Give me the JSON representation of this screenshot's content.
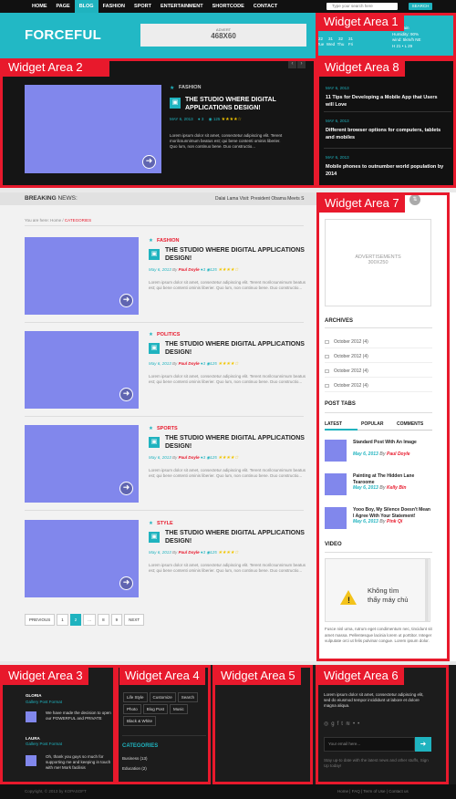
{
  "topnav": {
    "items": [
      "HOME",
      "PAGE",
      "BLOG",
      "FASHION",
      "SPORT",
      "ENTERTAINMENT",
      "SHORTCODE",
      "CONTACT"
    ],
    "active_index": 2,
    "search_placeholder": "Type your search here",
    "search_button": "SEARCH"
  },
  "header": {
    "logo": "FORCEFUL",
    "advert_small": "ADVERT",
    "advert_size": "468X60",
    "calendar": [
      {
        "day": "22",
        "wd": "Tue"
      },
      {
        "day": "31",
        "wd": "Wed"
      },
      {
        "day": "32",
        "wd": "Thu"
      },
      {
        "day": "31",
        "wd": "Fri"
      }
    ],
    "weather": [
      "Light rain",
      "Humidity: 90%",
      "wind: 5km/h NE",
      "H 21 • L 29"
    ]
  },
  "widget_labels": {
    "wa1": "Widget Area 1",
    "wa2": "Widget Area 2",
    "wa3": "Widget Area 3",
    "wa4": "Widget Area 4",
    "wa5": "Widget Area 5",
    "wa6": "Widget Area 6",
    "wa7": "Widget Area 7",
    "wa8": "Widget Area 8"
  },
  "featured": {
    "category": "FASHION",
    "title": "THE STUDIO WHERE DIGITAL APPLICATIONS DESIGN!",
    "date": "MAY 6, 2013",
    "comments": "3",
    "views": "125",
    "stars": "★★★★☆",
    "excerpt": "Lorem ipsum dolor sit amet, consectetur adipiscing elit. Terent morilcsunnimum beatus est; qui bene contenti ominis liberier. Quo lum, non continuo bene. Duo constructio..."
  },
  "right_news": [
    {
      "date": "MAY 6, 2013",
      "title": "11 Tips for Developing a Mobile App that Users will Love"
    },
    {
      "date": "MAY 6, 2013",
      "title": "Different browser options for computers, tablets and mobiles"
    },
    {
      "date": "MAY 6, 2013",
      "title": "Mobile phones to outnumber world population by 2014"
    }
  ],
  "breaking": {
    "label_bold": "BREAKING",
    "label_rest": " NEWS:",
    "ticker": "Dalai Lama Visit: President Obama Meets S"
  },
  "breadcrumb": {
    "prefix": "You are here:",
    "home": "Home",
    "sep": " / ",
    "current": "CATEGORIES"
  },
  "posts": [
    {
      "category": "FASHION",
      "title": "THE STUDIO WHERE DIGITAL APPLICATIONS DESIGN!",
      "date": "May 6, 2013",
      "author": "Paul Doyle",
      "comments": "3",
      "views": "125",
      "stars": "★★★★☆",
      "excerpt": "Lorem ipsum dolor sit amet, consectetur adipiscing elit. Terent morilcsunnimum beatus est; qui bene contenti ominis liberier. Quo lum, non continuo bene. Duo constructio..."
    },
    {
      "category": "POLITICS",
      "title": "THE STUDIO WHERE DIGITAL APPLICATIONS DESIGN!",
      "date": "May 6, 2013",
      "author": "Paul Doyle",
      "comments": "3",
      "views": "125",
      "stars": "★★★★☆",
      "excerpt": "Lorem ipsum dolor sit amet, consectetur adipiscing elit. Terent morilcsunnimum beatus est; qui bene contenti ominis liberier. Quo lum, non continuo bene. Duo constructio..."
    },
    {
      "category": "SPORTS",
      "title": "THE STUDIO WHERE DIGITAL APPLICATIONS DESIGN!",
      "date": "May 6, 2013",
      "author": "Paul Doyle",
      "comments": "3",
      "views": "125",
      "stars": "★★★★☆",
      "excerpt": "Lorem ipsum dolor sit amet, consectetur adipiscing elit. Terent morilcsunnimum beatus est; qui bene contenti ominis liberier. Quo lum, non continuo bene. Duo constructio..."
    },
    {
      "category": "STYLE",
      "title": "THE STUDIO WHERE DIGITAL APPLICATIONS DESIGN!",
      "date": "May 6, 2013",
      "author": "Paul Doyle",
      "comments": "3",
      "views": "125",
      "stars": "★★★★☆",
      "excerpt": "Lorem ipsum dolor sit amet, consectetur adipiscing elit. Terent morilcsunnimum beatus est; qui bene contenti ominis liberier. Quo lum, non continuo bene. Duo constructio..."
    }
  ],
  "pagination": {
    "prev": "PREVIOUS",
    "pages": [
      "1",
      "2",
      "...",
      "8",
      "9"
    ],
    "active": "2",
    "next": "NEXT"
  },
  "sidebar": {
    "ad_text": "ADVERTISEMENTS",
    "ad_size": "300X250",
    "archives_title": "ARCHIVES",
    "archives": [
      "October 2012 (4)",
      "October 2012 (4)",
      "October 2012 (4)",
      "October 2012 (4)"
    ],
    "posttabs_title": "POST TABS",
    "tabs": [
      "LATEST",
      "POPULAR",
      "COMMENTS"
    ],
    "tab_posts": [
      {
        "title": "Standard Post With An Image",
        "date": "May 6, 2013",
        "by": "By",
        "author": "Paul Doyle"
      },
      {
        "title": "Painting at The Hidden Lane Tearoome",
        "date": "May 6, 2013",
        "by": "By",
        "author": "Kelly Bin"
      },
      {
        "title": "Yooo Boy, My Silence Doesn't Mean I Agree With Your Statement!",
        "date": "May 6, 2013",
        "by": "By",
        "author": "Pink Qi"
      }
    ],
    "video_title": "VIDEO",
    "video_error": "Không tìm thấy máy chủ",
    "video_text": "Fusce nisl urna, rutrum eget condimentum nec, tincidunt sit amet massa. Pellentesque lacinia lorem ut porttitor. Integer vulputate orci ut felis pulvinar congue. Lorem ipsum dolor."
  },
  "footer": {
    "testimonials": [
      {
        "name": "GLORIA",
        "sub": "Gallery Post Format",
        "text": "We have made the decision to open our POWERFUL and PRIVATE"
      },
      {
        "name": "LAURA",
        "sub": "Gallery Post Format",
        "text": "Oh, thank you guys so much for supporting me and keeping in touch with me! Mork facilisis"
      }
    ],
    "tags": [
      "Life Style",
      "Customize",
      "Search",
      "Photo",
      "Blog Post",
      "Music",
      "Black & White"
    ],
    "categories_title": "CATEGORIES",
    "categories": [
      "Business (13)",
      "Education (2)"
    ],
    "about": "Lorem ipsum dolor sit amet, consectetur adipiscing elit, sed do eiusmod tempor incididunt ut labore et dolore magna aliqua.",
    "email_placeholder": "Your email here...",
    "subscribe_note": "Stay up-to date with the latest news and other stuffs, Sign Up today!",
    "copyright": "Copyright, © 2013 by KOPASOFT",
    "links": [
      "Home",
      "FAQ",
      "Term of Use",
      "Contact us"
    ]
  },
  "colors": {
    "accent": "#1fb3bf",
    "label_red": "#e8192c",
    "thumb": "#8187ec",
    "star": "#f2c500"
  }
}
